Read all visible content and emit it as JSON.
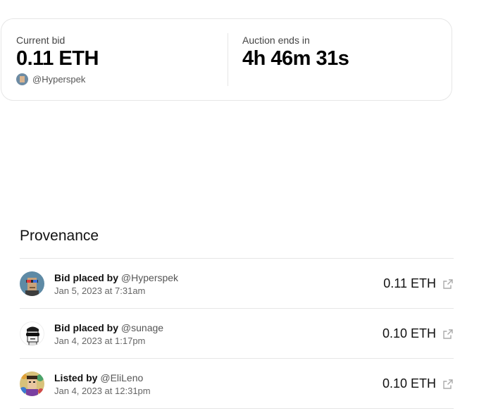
{
  "auction": {
    "current_bid_label": "Current bid",
    "current_bid_value": "0.11 ETH",
    "current_bidder": "@Hyperspek",
    "ends_label": "Auction ends in",
    "ends_value": "4h 46m 31s"
  },
  "provenance": {
    "title": "Provenance",
    "items": [
      {
        "action": "Bid placed by",
        "handle": "@Hyperspek",
        "date": "Jan 5, 2023 at 7:31am",
        "amount": "0.11 ETH",
        "icon": "external-link-icon"
      },
      {
        "action": "Bid placed by",
        "handle": "@sunage",
        "date": "Jan 4, 2023 at 1:17pm",
        "amount": "0.10 ETH",
        "icon": "external-link-icon"
      },
      {
        "action": "Listed by",
        "handle": "@EliLeno",
        "date": "Jan 4, 2023 at 12:31pm",
        "amount": "0.10 ETH",
        "icon": "external-link-icon"
      }
    ]
  }
}
